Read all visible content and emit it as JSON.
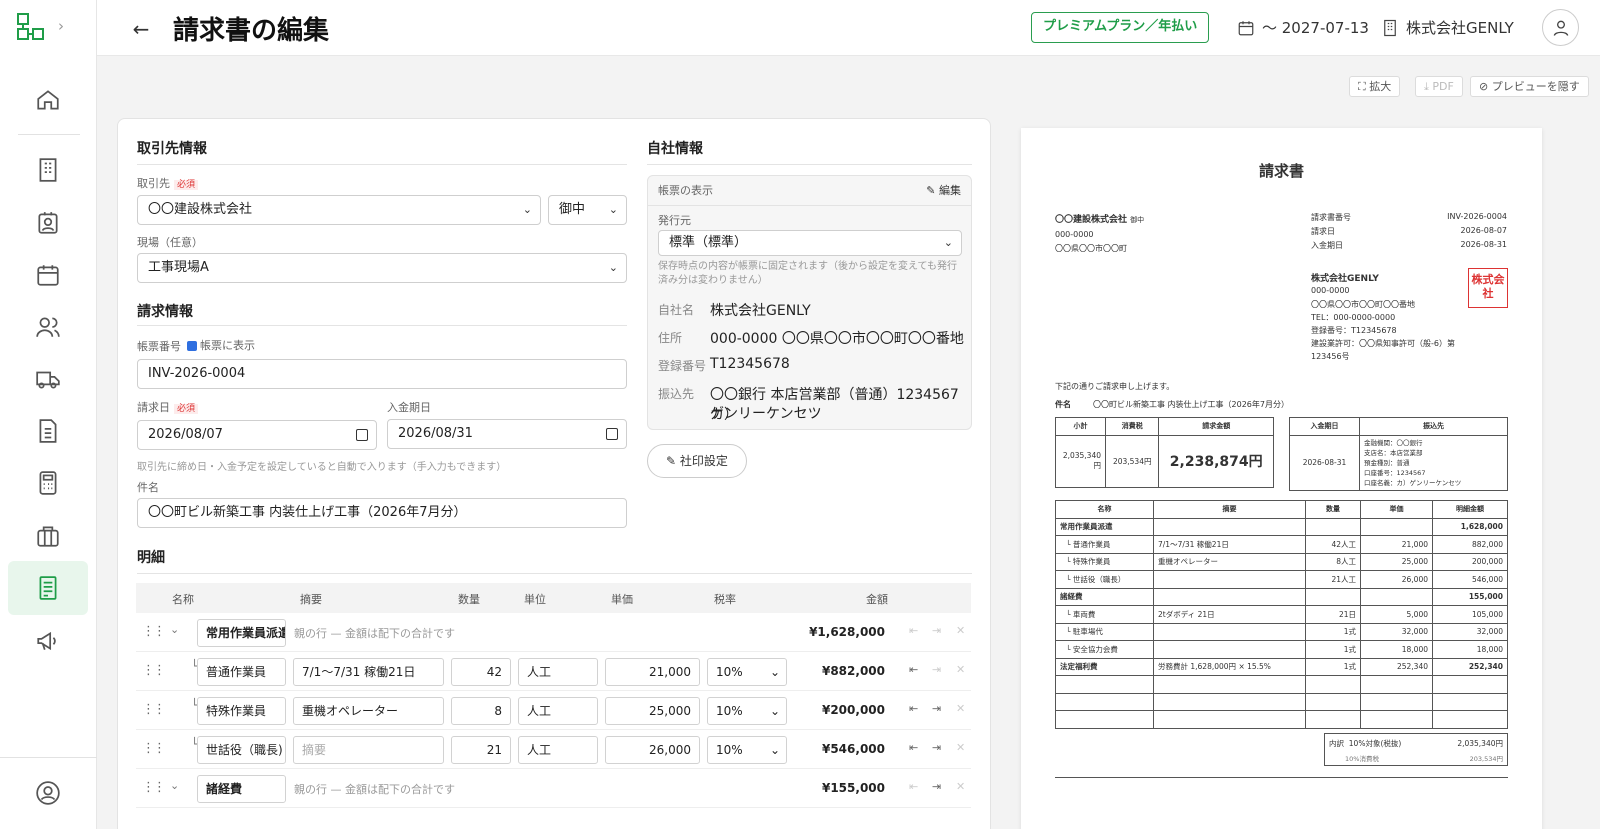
{
  "header": {
    "title": "請求書の編集",
    "plan": "プレミアムプラン／年払い",
    "expiry": "〜 2027-07-13",
    "company": "株式会社GENLY"
  },
  "sidebar": {
    "items": [
      "home-icon",
      "building-icon",
      "id-badge-icon",
      "calendar-icon",
      "users-icon",
      "truck-icon",
      "document-icon",
      "calculator-icon",
      "briefcase-icon",
      "invoice-icon",
      "megaphone-icon",
      "account-icon"
    ]
  },
  "toolbar": {
    "expand": "拡大",
    "pdf": "PDF",
    "hide": "プレビューを隠す"
  },
  "client": {
    "section": "取引先情報",
    "client_label": "取引先",
    "required": "必須",
    "client_value": "〇〇建設株式会社",
    "honorific": "御中",
    "site_label": "現場（任意）",
    "site_value": "工事現場A"
  },
  "invoice": {
    "section": "請求情報",
    "number_label": "帳票番号",
    "show_on_doc": "帳票に表示",
    "number_value": "INV-2026-0004",
    "date_label": "請求日",
    "date_value": "2026/08/07",
    "due_label": "入金期日",
    "due_value": "2026/08/31",
    "auto_hint": "取引先に締め日・入金予定を設定していると自動で入ります（手入力もできます）",
    "subject_label": "件名",
    "subject_value": "〇〇町ビル新築工事 内装仕上げ工事（2026年7月分）"
  },
  "company": {
    "section": "自社情報",
    "display_label": "帳票の表示",
    "edit": "編集",
    "issuer_label": "発行元",
    "issuer_value": "標準（標準）",
    "issuer_hint": "保存時点の内容が帳票に固定されます（後から設定を変えても発行済み分は変わりません）",
    "name_k": "自社名",
    "name_v": "株式会社GENLY",
    "addr_k": "住所",
    "addr_v": "000-0000 〇〇県〇〇市〇〇町〇〇番地",
    "reg_k": "登録番号",
    "reg_v": "T12345678",
    "bank_k": "振込先",
    "bank_v1": "〇〇銀行 本店営業部（普通）1234567 カ）",
    "bank_v2": "ゲンリーケンセツ",
    "stamp_button": "社印設定"
  },
  "details": {
    "section": "明細",
    "headers": {
      "name": "名称",
      "summary": "摘要",
      "qty": "数量",
      "unit": "単位",
      "price": "単価",
      "tax": "税率",
      "amount": "金額"
    },
    "parent_note": "親の行 — 金額は配下の合計です",
    "summary_ph": "摘要",
    "rows": [
      {
        "name": "常用作業員派遣",
        "amount": "¥1,628,000"
      },
      {
        "name": "普通作業員",
        "summary": "7/1〜7/31 稼働21日",
        "qty": "42",
        "unit": "人工",
        "price": "21,000",
        "tax": "10%",
        "amount": "¥882,000"
      },
      {
        "name": "特殊作業員",
        "summary": "重機オペレーター",
        "qty": "8",
        "unit": "人工",
        "price": "25,000",
        "tax": "10%",
        "amount": "¥200,000"
      },
      {
        "name": "世話役（職長)",
        "qty": "21",
        "unit": "人工",
        "price": "26,000",
        "tax": "10%",
        "amount": "¥546,000"
      },
      {
        "name": "諸経費",
        "amount": "¥155,000"
      }
    ]
  },
  "preview": {
    "title": "請求書",
    "to": "〇〇建設株式会社",
    "to_suffix": "御中",
    "to_zip": "000-0000",
    "to_addr": "〇〇県〇〇市〇〇町",
    "meta": [
      [
        "請求書番号",
        "INV-2026-0004"
      ],
      [
        "請求日",
        "2026-08-07"
      ],
      [
        "入金期日",
        "2026-08-31"
      ]
    ],
    "co_name": "株式会社GENLY",
    "co_lines": [
      "000-0000",
      "〇〇県〇〇市〇〇町〇〇番地",
      "TEL：000-0000-0000",
      "登録番号：T12345678",
      "建設業許可：〇〇県知事許可（般-6）第",
      "123456号"
    ],
    "seal": "株式会社",
    "intro": "下記の通りご請求申し上げます。",
    "subject_k": "件名",
    "subject_v": "〇〇町ビル新築工事 内装仕上げ工事（2026年7月分）",
    "sum_h": [
      "小計",
      "消費税",
      "請求金額"
    ],
    "subtotal": "2,035,340円",
    "tax": "203,534円",
    "total": "2,238,874円",
    "pay_h": [
      "入金期日",
      "振込先"
    ],
    "pay_date": "2026-08-31",
    "bank_lines": [
      "金融機関：〇〇銀行",
      "支店名：本店営業部",
      "預金種別：普通",
      "口座番号：1234567",
      "口座名義：カ）ゲンリーケンセツ"
    ],
    "item_h": [
      "名称",
      "摘要",
      "数量",
      "単価",
      "明細金額"
    ],
    "items": [
      [
        "常用作業員派遣",
        "",
        "",
        "",
        "1,628,000"
      ],
      [
        "└ 普通作業員",
        "7/1〜7/31 稼働21日",
        "42人工",
        "21,000",
        "882,000"
      ],
      [
        "└ 特殊作業員",
        "重機オペレーター",
        "8人工",
        "25,000",
        "200,000"
      ],
      [
        "└ 世話役（職長）",
        "",
        "21人工",
        "26,000",
        "546,000"
      ],
      [
        "諸経費",
        "",
        "",
        "",
        "155,000"
      ],
      [
        "└ 車両費",
        "2tダボディ 21日",
        "21日",
        "5,000",
        "105,000"
      ],
      [
        "└ 駐車場代",
        "",
        "1式",
        "32,000",
        "32,000"
      ],
      [
        "└ 安全協力会費",
        "",
        "1式",
        "18,000",
        "18,000"
      ],
      [
        "法定福利費",
        "労務費計 1,628,000円 × 15.5%",
        "1式",
        "252,340",
        "252,340"
      ],
      [
        "",
        "",
        "",
        "",
        ""
      ],
      [
        "",
        "",
        "",
        "",
        ""
      ],
      [
        "",
        "",
        "",
        "",
        ""
      ]
    ],
    "bd_k": "内訳",
    "bd_label": "10%対象(税抜)",
    "bd_val": "2,035,340円",
    "bd_tax_label": "10%消費税",
    "bd_tax": "203,534円"
  }
}
